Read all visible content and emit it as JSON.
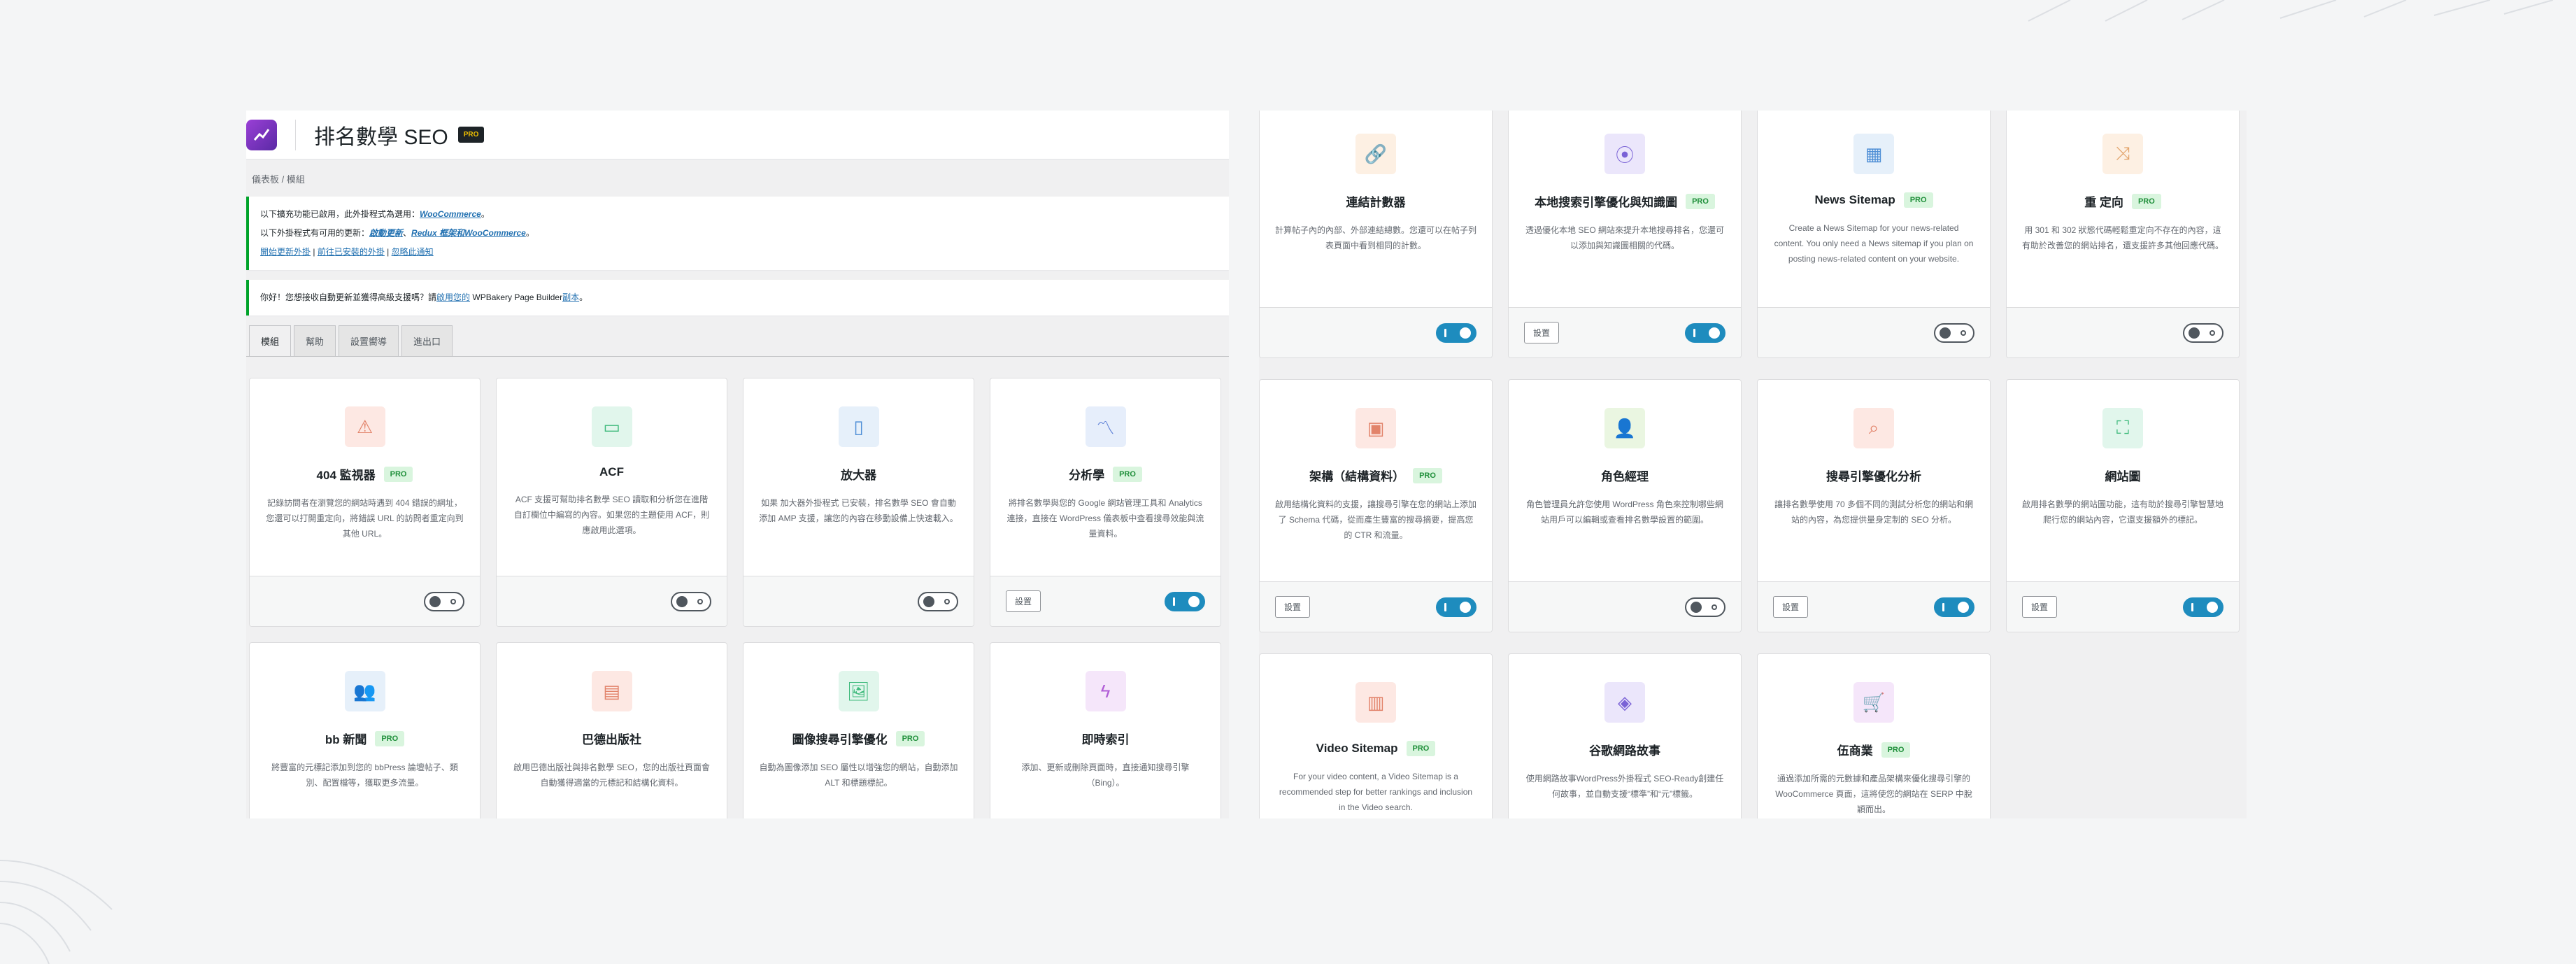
{
  "header": {
    "title": "排名數學 SEO",
    "badge": "PRO"
  },
  "breadcrumb": "儀表板 / 模組",
  "notices": {
    "line1_prefix": "以下擴充功能已啟用，此外掛程式為選用：",
    "line1_link": "WooCommerce",
    "line1_suffix": "。",
    "line2_prefix": "以下外掛程式有可用的更新：",
    "line2_link1": "啟動更新",
    "line2_mid": "、",
    "line2_link2": "Redux 框架和",
    "line2_link3": "WooCommerce",
    "line2_suffix": "。",
    "line3_link1": "開始更新外掛",
    "line3_link2": "前往已安裝的外掛",
    "line3_link3": "忽略此通知",
    "wpbakery_prefix": "你好！您想接收自動更新並獲得高級支援嗎？請",
    "wpbakery_link1": "啟用您的",
    "wpbakery_mid": " WPBakery Page Builder",
    "wpbakery_link2": "副本",
    "wpbakery_suffix": "。"
  },
  "tabs": [
    "模組",
    "幫助",
    "設置嚮導",
    "進出口"
  ],
  "icons": {
    "warning": "warning-icon",
    "monitor": "monitor-icon",
    "phone": "phone-icon",
    "chart": "chart-icon",
    "users": "users-icon",
    "address": "address-card-icon",
    "image": "image-icon",
    "bolt": "bolt-icon",
    "link": "link-icon",
    "pin": "map-pin-icon",
    "news": "news-icon",
    "shuffle": "shuffle-icon",
    "schema": "schema-icon",
    "user": "user-icon",
    "search": "search-icon",
    "sitemap": "sitemap-icon",
    "video": "video-icon",
    "layers": "layers-icon",
    "cart": "cart-icon"
  },
  "labels": {
    "settings": "設置",
    "pro": "PRO"
  },
  "left_cards": [
    {
      "title": "404 監視器",
      "pro": true,
      "icon": "⚠",
      "icon_bg": "#fde8e3",
      "icon_color": "#e2836a",
      "desc": "記錄訪問者在瀏覽您的網站時遇到 404 錯誤的網址，您還可以打開重定向，將錯誤 URL 的訪問者重定向到其他 URL。",
      "settings": false,
      "on": false
    },
    {
      "title": "ACF",
      "pro": false,
      "icon": "▭",
      "icon_bg": "#e1f6ec",
      "icon_color": "#3fba7c",
      "desc": "ACF 支援可幫助排名數學 SEO 讀取和分析您在進階自訂欄位中編寫的內容。如果您的主題使用 ACF，則應啟用此選項。",
      "settings": false,
      "on": false
    },
    {
      "title": "放大器",
      "pro": false,
      "icon": "▯",
      "icon_bg": "#e6f0fa",
      "icon_color": "#4f8fd6",
      "desc": "如果 加大器外掛程式 已安裝，排名數學 SEO 會自動添加 AMP 支援，讓您的內容在移動設備上快速載入。",
      "desc_link": "加大器外掛程式",
      "settings": false,
      "on": false
    },
    {
      "title": "分析學",
      "pro": true,
      "icon": "〽",
      "icon_bg": "#e6eefb",
      "icon_color": "#5b7fd6",
      "desc": "將排名數學與您的 Google 網站管理工具和 Analytics 連接，直接在 WordPress 儀表板中查看搜尋效能與流量資料。",
      "settings": true,
      "on": true
    },
    {
      "title": "bb 新聞",
      "pro": true,
      "icon": "👥",
      "icon_bg": "#e6f0fa",
      "icon_color": "#4f8fd6",
      "desc": "將豐富的元標記添加到您的 bbPress 論壇帖子、類別、配置檔等，獲取更多流量。",
      "settings": false,
      "on": false
    },
    {
      "title": "巴德出版社",
      "pro": false,
      "icon": "▤",
      "icon_bg": "#fde8e3",
      "icon_color": "#e2836a",
      "desc": "啟用巴德出版社與排名數學 SEO，您的出版社頁面會自動獲得適當的元標記和結構化資料。",
      "settings": false,
      "on": false
    },
    {
      "title": "圖像搜尋引擎優化",
      "pro": true,
      "icon": "🖼",
      "icon_bg": "#e1f6ec",
      "icon_color": "#3fba7c",
      "desc": "自動為圖像添加 SEO 屬性以增強您的網站，自動添加 ALT 和標題標記。",
      "settings": false,
      "on": false
    },
    {
      "title": "即時索引",
      "pro": false,
      "icon": "ϟ",
      "icon_bg": "#f5e6fa",
      "icon_color": "#b05cd6",
      "desc": "添加、更新或刪除頁面時，直接通知搜尋引擎（Bing）。",
      "settings": false,
      "on": false
    }
  ],
  "right_cards": [
    {
      "title": "連結計數器",
      "pro": false,
      "icon": "🔗",
      "icon_bg": "#fdf0e3",
      "icon_color": "#e2a36a",
      "desc": "計算帖子內的內部、外部連結總數。您還可以在帖子列表頁面中看到相同的計數。",
      "settings": false,
      "on": true
    },
    {
      "title": "本地搜索引擎優化與知識圖",
      "pro": true,
      "icon": "⦿",
      "icon_bg": "#ebe6fb",
      "icon_color": "#7a62d6",
      "desc": "透過優化本地 SEO 網站來提升本地搜尋排名，您還可以添加與知識圖相關的代碼。",
      "settings": true,
      "on": true
    },
    {
      "title": "News Sitemap",
      "pro": true,
      "icon": "▦",
      "icon_bg": "#e6f0fa",
      "icon_color": "#4f8fd6",
      "desc": "Create a News Sitemap for your news-related content. You only need a News sitemap if you plan on posting news-related content on your website.",
      "settings": false,
      "on": false
    },
    {
      "title": "重 定向",
      "pro": true,
      "icon": "⤨",
      "icon_bg": "#fdf0e3",
      "icon_color": "#e2a36a",
      "desc": "用 301 和 302 狀態代碼輕鬆重定向不存在的內容，這有助於改善您的網站排名，還支援許多其他回應代碼。",
      "settings": false,
      "on": false
    },
    {
      "title": "架構（結構資料）",
      "pro": true,
      "icon": "▣",
      "icon_bg": "#fde8e3",
      "icon_color": "#e2836a",
      "desc": "啟用結構化資料的支援，讓搜尋引擎在您的網站上添加了 Schema 代碼，從而產生豐富的搜尋摘要，提高您的 CTR 和流量。",
      "settings": true,
      "on": true
    },
    {
      "title": "角色經理",
      "pro": false,
      "icon": "👤",
      "icon_bg": "#eaf6e1",
      "icon_color": "#6aab3f",
      "desc": "角色管理員允許您使用 WordPress 角色來控制哪些網站用戶可以編輯或查看排名數學設置的範圍。",
      "settings": false,
      "on": false
    },
    {
      "title": "搜尋引擎優化分析",
      "pro": false,
      "icon": "⌕",
      "icon_bg": "#fde8e3",
      "icon_color": "#e2836a",
      "desc": "讓排名數學使用 70 多個不同的測試分析您的網站和網站的內容，為您提供量身定制的 SEO 分析。",
      "settings": true,
      "on": true
    },
    {
      "title": "網站圖",
      "pro": false,
      "icon": "⛶",
      "icon_bg": "#e1f6ec",
      "icon_color": "#3fba7c",
      "desc": "啟用排名數學的網站圖功能，這有助於搜尋引擎智慧地爬行您的網站內容，它還支援額外的標記。",
      "settings": true,
      "on": true
    },
    {
      "title": "Video Sitemap",
      "pro": true,
      "icon": "▥",
      "icon_bg": "#fde8e3",
      "icon_color": "#e2836a",
      "desc": "For your video content, a Video Sitemap is a recommended step for better rankings and inclusion in the Video search.",
      "settings": false,
      "on": false
    },
    {
      "title": "谷歌網路故事",
      "pro": false,
      "icon": "◈",
      "icon_bg": "#ebe6fb",
      "icon_color": "#7a62d6",
      "desc": "使用網路故事WordPress外掛程式 SEO-Ready創建任何故事，並自動支援“標準”和“元”標籤。",
      "settings": false,
      "on": false
    },
    {
      "title": "伍商業",
      "pro": true,
      "icon": "🛒",
      "icon_bg": "#f5e6fa",
      "icon_color": "#b05cd6",
      "desc": "通過添加所需的元數據和產品架構來優化搜尋引擎的 WooCommerce 頁面，這將使您的網站在 SERP 中脫穎而出。",
      "settings": false,
      "on": false
    }
  ]
}
